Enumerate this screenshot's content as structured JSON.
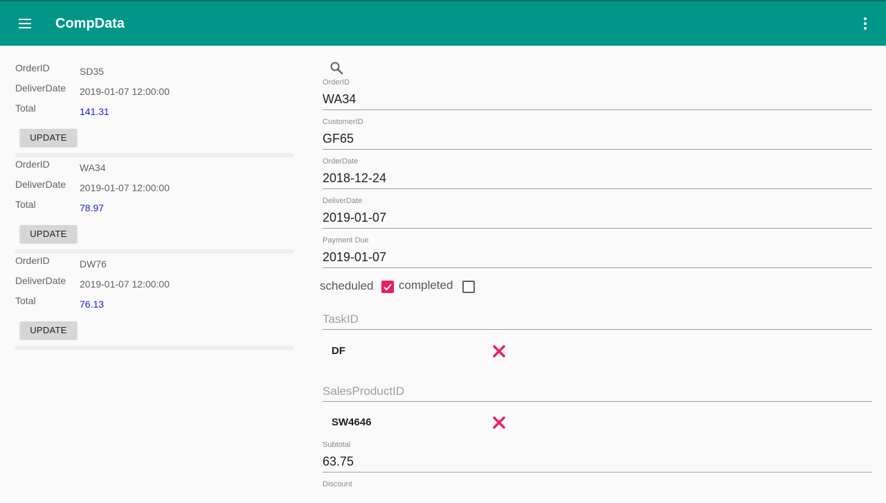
{
  "app": {
    "title": "CompData"
  },
  "orders": [
    {
      "order_label": "OrderID",
      "order_id": "SD35",
      "deliver_label": "DeliverDate",
      "deliver_date": "2019-01-07 12:00:00",
      "total_label": "Total",
      "total": "141.31",
      "button_label": "UPDATE"
    },
    {
      "order_label": "OrderID",
      "order_id": "WA34",
      "deliver_label": "DeliverDate",
      "deliver_date": "2019-01-07 12:00:00",
      "total_label": "Total",
      "total": "78.97",
      "button_label": "UPDATE"
    },
    {
      "order_label": "OrderID",
      "order_id": "DW76",
      "deliver_label": "DeliverDate",
      "deliver_date": "2019-01-07 12:00:00",
      "total_label": "Total",
      "total": "76.13",
      "button_label": "UPDATE"
    }
  ],
  "form": {
    "order_id": {
      "label": "OrderID",
      "value": "WA34"
    },
    "customer_id": {
      "label": "CustomerID",
      "value": "GF65"
    },
    "order_date": {
      "label": "OrderDate",
      "value": "2018-12-24"
    },
    "deliver_date": {
      "label": "DeliverDate",
      "value": "2019-01-07"
    },
    "payment_due": {
      "label": "Payment Due",
      "value": "2019-01-07"
    },
    "scheduled": {
      "label": "scheduled",
      "checked": true
    },
    "completed": {
      "label": "completed",
      "checked": false
    },
    "task_id": {
      "placeholder": "TaskID",
      "item": "DF"
    },
    "sales_product_id": {
      "placeholder": "SalesProductID",
      "item": "SW4646"
    },
    "subtotal": {
      "label": "Subtotal",
      "value": "63.75"
    },
    "discount": {
      "label": "Discount"
    }
  },
  "colors": {
    "appbar": "#009688",
    "accent": "#e91e63",
    "total_link": "#1a1ae6"
  },
  "icons": {
    "menu": "menu-icon",
    "overflow": "more-vert-icon",
    "search": "search-icon",
    "remove": "close-icon"
  }
}
